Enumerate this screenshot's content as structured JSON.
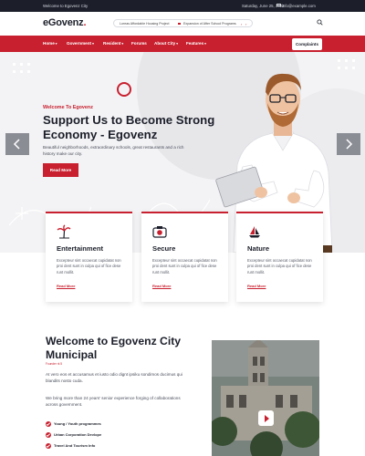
{
  "topbar": {
    "welcome": "Welcome to Egovenz City",
    "date": "Saturday, June 25, 2022",
    "email": "info@example.com"
  },
  "header": {
    "logo_text": "eGovenz",
    "logo_dot": ".",
    "ticker": [
      "Loreas Affordable Housing Project",
      "Expansion of After School Programs"
    ]
  },
  "nav": {
    "items": [
      {
        "label": "Home",
        "dropdown": true
      },
      {
        "label": "Government",
        "dropdown": true
      },
      {
        "label": "Resident",
        "dropdown": true
      },
      {
        "label": "Forums",
        "dropdown": false
      },
      {
        "label": "About City",
        "dropdown": true
      },
      {
        "label": "Features",
        "dropdown": true
      }
    ],
    "cta": "Complaints"
  },
  "hero": {
    "tagline": "Welcome To Egovenz",
    "title": "Support Us to Become Strong Economy - Egovenz",
    "description": "Beautiful neighborhoods, extraordinary schools, great restaurants and a rich history make our city.",
    "button": "Read More"
  },
  "cards": [
    {
      "icon": "palm-tree-icon",
      "title": "Entertainment",
      "text": "Excepteur sint occaecat cupidatat non proi dent sunt in culpa qui of fice dese runt mollit.",
      "link": "Read More"
    },
    {
      "icon": "camera-icon",
      "title": "Secure",
      "text": "Excepteur sint occaecat cupidatat non proi dent sunt in culpa qui of fice dese runt mollit.",
      "link": "Read More"
    },
    {
      "icon": "sailboat-icon",
      "title": "Nature",
      "text": "Excepteur sint occaecat cupidatat non proi dent sunt in culpa qui of fice dese runt mollit.",
      "link": "Read More"
    }
  ],
  "about": {
    "title": "Welcome to Egovenz City Municipal",
    "subtitle": "Founder rk 5",
    "para1": "At vero eos et accusamus et iusto odio dignt ipsiku sondimos ducimus qui blandits nosto cuda.",
    "para2": "We bring more than 24 years' senior experience forging of collaborations across government.",
    "list": [
      "Young / Youth programmes",
      "Urban Corporation Devlope",
      "Travel And Tourism Info"
    ]
  },
  "colors": {
    "accent": "#c8202f",
    "dark": "#1c1f2a",
    "hero_bg": "#f3f3f5"
  }
}
